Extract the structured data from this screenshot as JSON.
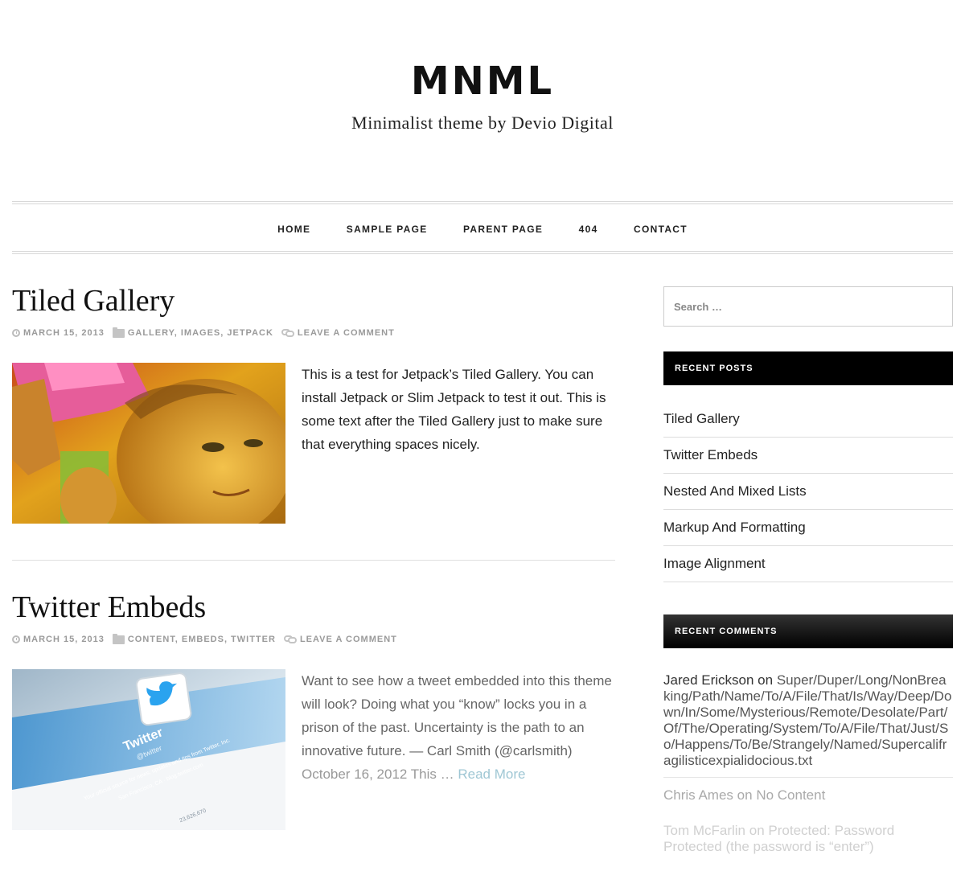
{
  "site": {
    "title": "MNML",
    "description": "Minimalist theme by Devio Digital"
  },
  "nav": {
    "items": [
      "HOME",
      "SAMPLE PAGE",
      "PARENT PAGE",
      "404",
      "CONTACT"
    ]
  },
  "posts": [
    {
      "title": "Tiled Gallery",
      "date": "MARCH 15, 2013",
      "categories": "GALLERY, IMAGES, JETPACK",
      "comment_link": "LEAVE A COMMENT",
      "excerpt": "This is a test for Jetpack’s Tiled Gallery. You can install Jetpack or Slim Jetpack to test it out. This is some text after the Tiled Gallery just to make sure that everything spaces nicely."
    },
    {
      "title": "Twitter Embeds",
      "date": "MARCH 15, 2013",
      "categories": "CONTENT, EMBEDS, TWITTER",
      "comment_link": "LEAVE A COMMENT",
      "excerpt": "Want to see how a tweet embedded into this theme will look? Doing what you “know” locks you in a prison of the past. Uncertainty is the path to an innovative future. — Carl Smith (@carlsmith)",
      "excerpt_tail": "October 16, 2012 This …",
      "read_more": "Read More",
      "thumb_text": {
        "name": "Twitter",
        "handle": "@twitter",
        "bio": "Your official source for news, updates and tips from Twitter, Inc.",
        "location": "San Francisco, CA · blog.twitter.com",
        "count": "23,626,670"
      }
    }
  ],
  "sidebar": {
    "search_placeholder": "Search …",
    "recent_posts_title": "RECENT POSTS",
    "recent_posts": [
      "Tiled Gallery",
      "Twitter Embeds",
      "Nested And Mixed Lists",
      "Markup And Formatting",
      "Image Alignment"
    ],
    "recent_comments_title": "RECENT COMMENTS",
    "comments": [
      {
        "author": "Jared Erickson",
        "on": "on",
        "target": "Super/Duper/Long/NonBreaking/Path/Name/To/A/File/That/Is/Way/Deep/Down/In/Some/Mysterious/Remote/Desolate/Part/Of/The/Operating/System/To/A/File/That/Just/So/Happens/To/Be/Strangely/Named/Supercalifragilisticexpialidocious.txt"
      },
      {
        "author": "Chris Ames",
        "on": "on",
        "target": "No Content"
      },
      {
        "author": "Tom McFarlin",
        "on": "on",
        "target": "Protected: Password Protected (the password is “enter”)"
      }
    ]
  },
  "colors": {
    "read_more": "#9fc7d4",
    "widget_bg": "#000000",
    "meta": "#9a9a9a"
  }
}
